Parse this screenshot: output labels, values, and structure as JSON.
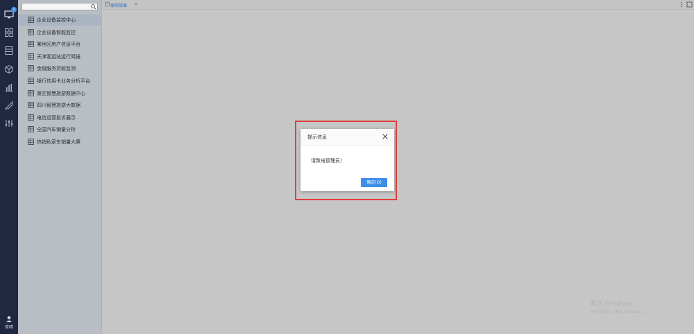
{
  "sidebar": {
    "badge_count": "1",
    "user_label": "荩晴",
    "nav_icons": [
      "monitor-icon",
      "grid-icon",
      "database-icon",
      "box-icon",
      "bar-chart-icon",
      "pen-icon",
      "filter-icon"
    ],
    "items": [
      {
        "label": "企业设备监控中心"
      },
      {
        "label": "企业设备智能监控"
      },
      {
        "label": "某地区房产信息平台"
      },
      {
        "label": "天津客运站运行简报"
      },
      {
        "label": "金融服务贷款监测"
      },
      {
        "label": "银行信用卡业务分析平台"
      },
      {
        "label": "景区智慧旅游数据中心"
      },
      {
        "label": "四川智慧旅游大数据"
      },
      {
        "label": "电信运营投诉展示"
      },
      {
        "label": "全国汽车销量分析"
      },
      {
        "label": "热销私家车销量大屏"
      }
    ],
    "active_index": 0
  },
  "tabs": [
    {
      "label": "案例效果",
      "close": "×"
    }
  ],
  "dialog": {
    "title": "提示信息",
    "message": "请致电管理员！",
    "ok_label": "确定(O)"
  },
  "watermark": {
    "line1": "激活 Windows",
    "line2": "转到\"设置\"以激活 Windows。"
  },
  "colors": {
    "accent": "#3d8ee8",
    "iconbar_bg": "#1f2840",
    "highlight": "#e0403a"
  }
}
